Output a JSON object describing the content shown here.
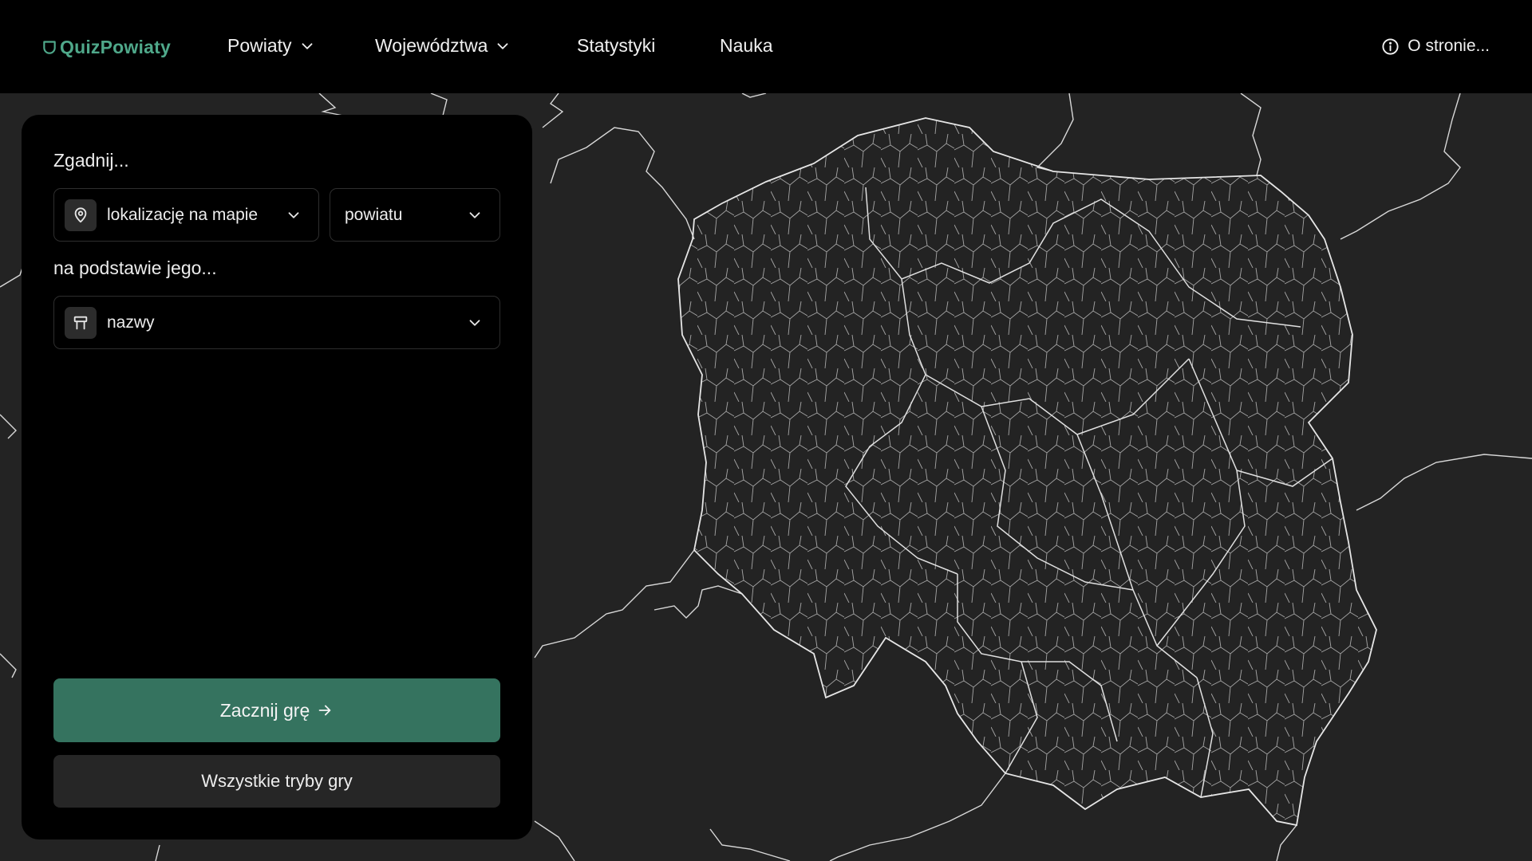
{
  "brand": {
    "name": "QuizPowiaty",
    "logo_icon": "shield-icon",
    "color": "#4fa88a"
  },
  "nav": {
    "items": [
      {
        "label": "Powiaty",
        "has_dropdown": true
      },
      {
        "label": "Województwa",
        "has_dropdown": true
      },
      {
        "label": "Statystyki",
        "has_dropdown": false
      },
      {
        "label": "Nauka",
        "has_dropdown": false
      }
    ],
    "about": {
      "label": "O stronie...",
      "icon": "info-icon"
    }
  },
  "panel": {
    "guess_label": "Zgadnij...",
    "guess_type": {
      "value": "lokalizację na mapie",
      "icon": "map-pin-icon"
    },
    "entity_type": {
      "value": "powiatu"
    },
    "based_on_label": "na podstawie jego...",
    "based_on": {
      "value": "nazwy",
      "icon": "signpost-icon"
    },
    "start_button": "Zacznij grę",
    "all_modes_button": "Wszystkie tryby gry"
  },
  "colors": {
    "background": "#232323",
    "panel": "#000000",
    "accent": "#35735f",
    "map_lines": "#cfcfcf"
  }
}
